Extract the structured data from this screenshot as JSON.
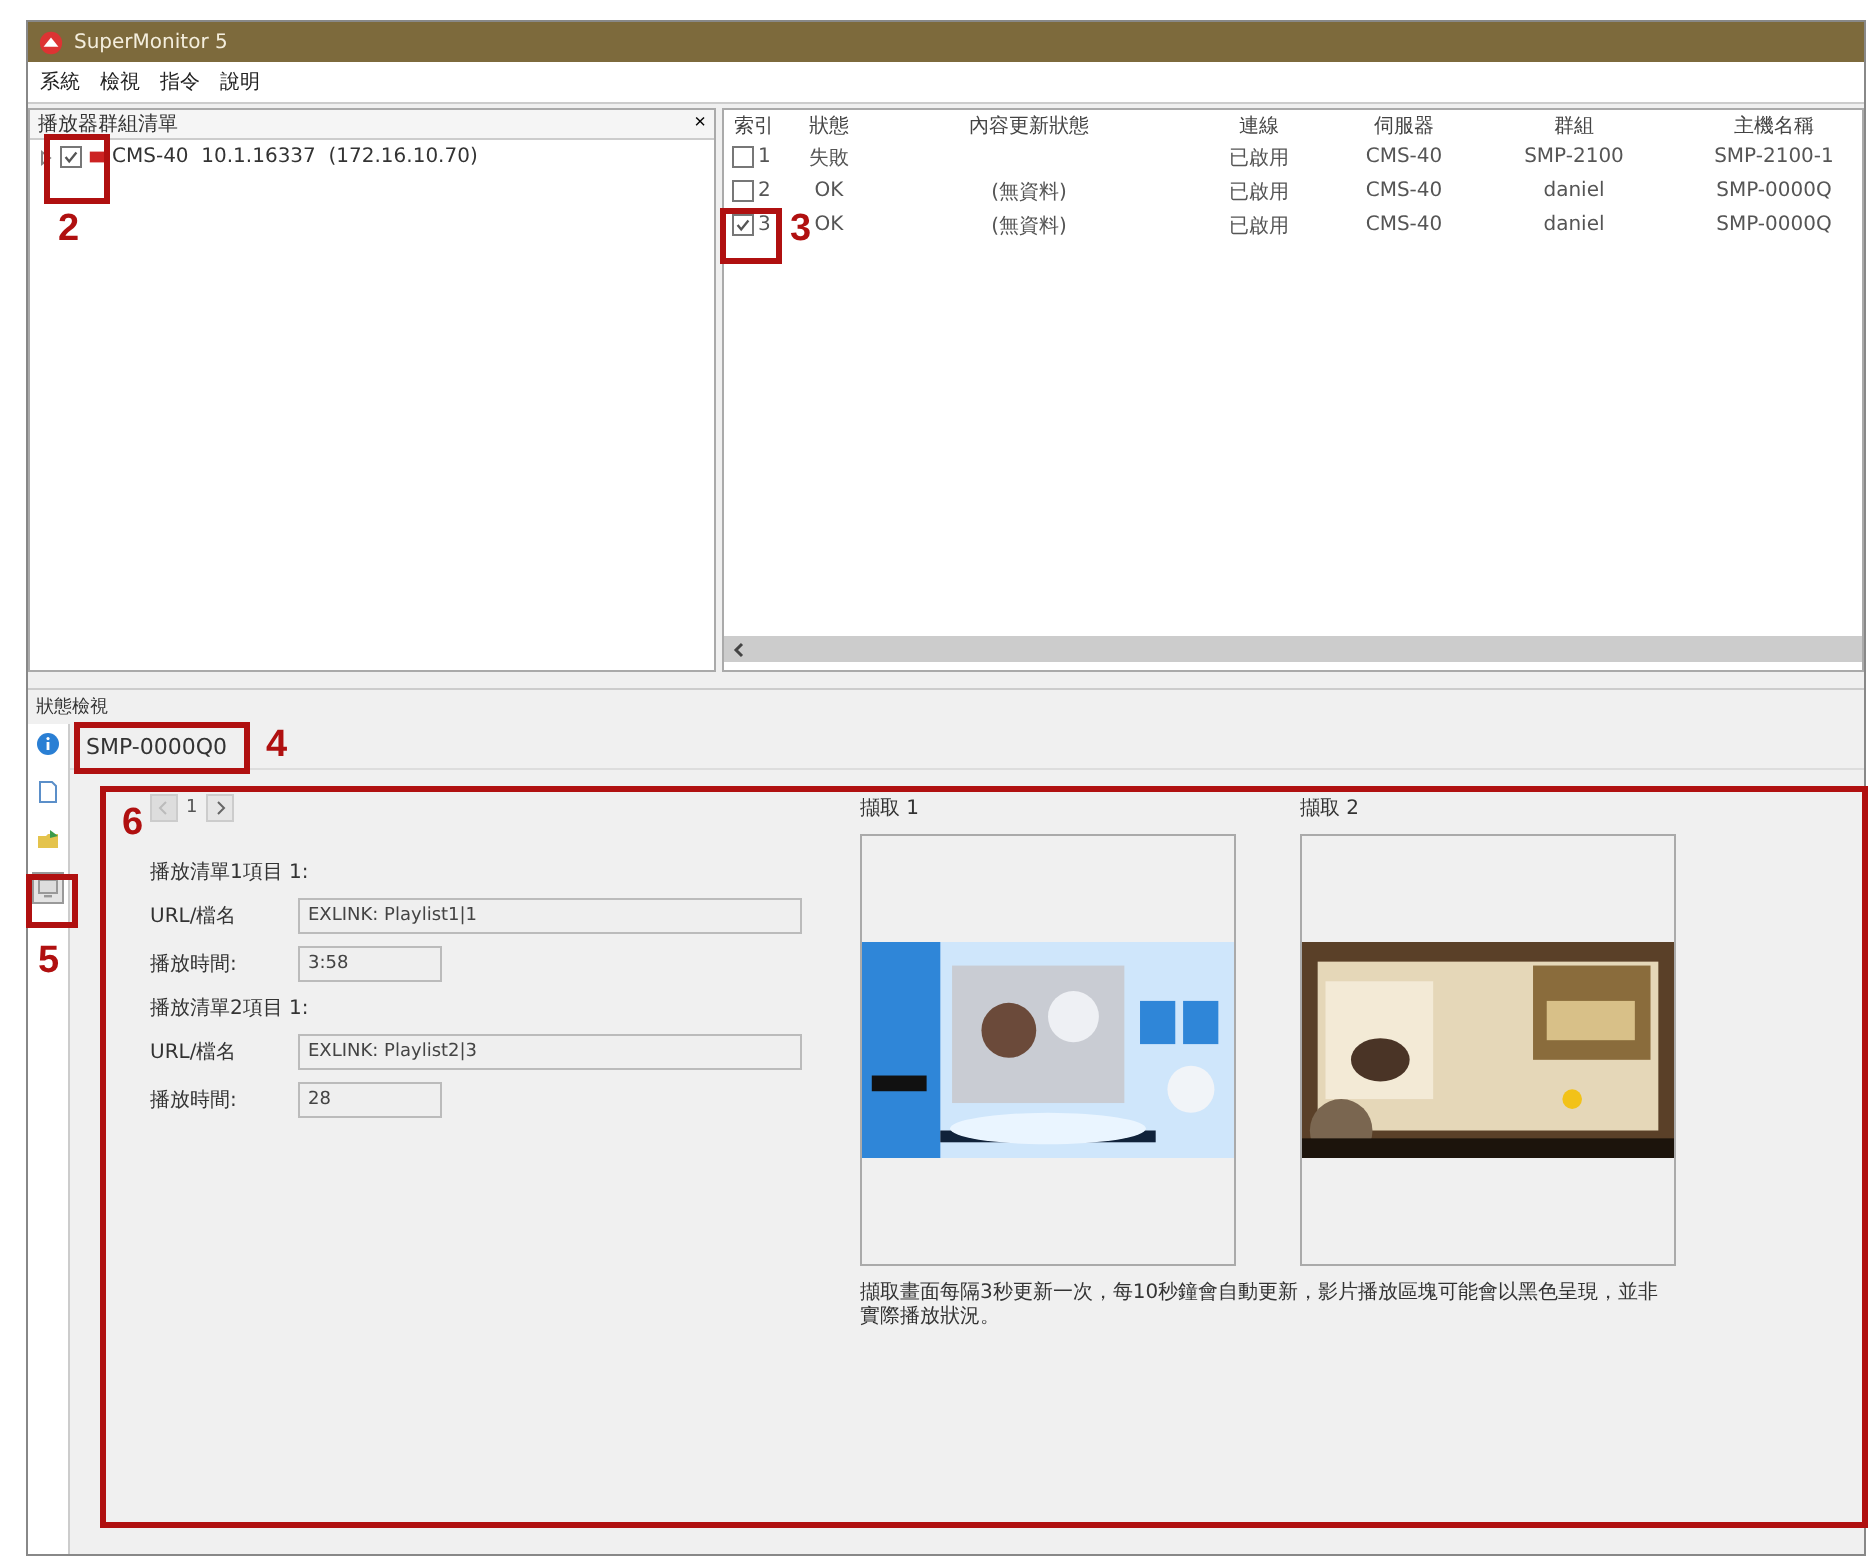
{
  "window": {
    "title": "SuperMonitor 5"
  },
  "menu": [
    "系統",
    "檢視",
    "指令",
    "說明"
  ],
  "tree_panel": {
    "title": "播放器群組清單",
    "close": "×",
    "items": [
      {
        "label": "CMS-40  10.1.16337  (172.16.10.70)",
        "checked": true,
        "expanded": false
      }
    ]
  },
  "table": {
    "columns": [
      "索引",
      "狀態",
      "內容更新狀態",
      "連線",
      "伺服器",
      "群組",
      "主機名稱"
    ],
    "rows": [
      {
        "checked": false,
        "cells": [
          "1",
          "失敗",
          "",
          "已啟用",
          "CMS-40",
          "SMP-2100",
          "SMP-2100-1"
        ]
      },
      {
        "checked": false,
        "cells": [
          "2",
          "OK",
          "(無資料)",
          "已啟用",
          "CMS-40",
          "daniel",
          "SMP-0000Q"
        ]
      },
      {
        "checked": true,
        "cells": [
          "3",
          "OK",
          "(無資料)",
          "已啟用",
          "CMS-40",
          "daniel",
          "SMP-0000Q"
        ]
      }
    ]
  },
  "status_panel": {
    "title": "狀態檢視",
    "player_name": "SMP-0000Q0",
    "side_tabs": [
      {
        "kind": "info",
        "selected": false
      },
      {
        "kind": "document",
        "selected": false
      },
      {
        "kind": "folder",
        "selected": false
      },
      {
        "kind": "screen",
        "selected": true
      }
    ],
    "page": "1",
    "playlists": [
      {
        "heading": "播放清單1項目 1:",
        "url_label": "URL/檔名",
        "url": "EXLINK: Playlist1|1",
        "time_label": "播放時間:",
        "time": "3:58"
      },
      {
        "heading": "播放清單2項目 1:",
        "url_label": "URL/檔名",
        "url": "EXLINK: Playlist2|3",
        "time_label": "播放時間:",
        "time": "28"
      }
    ],
    "captures": [
      {
        "label": "擷取 1",
        "kind": "picture"
      },
      {
        "label": "擷取 2",
        "kind": "picture"
      }
    ],
    "note": "擷取畫面每隔3秒更新一次，每10秒鐘會自動更新，影片播放區塊可能會以黑色呈現，並非實際播放狀況。"
  },
  "callouts": [
    "2",
    "3",
    "4",
    "5",
    "6"
  ]
}
